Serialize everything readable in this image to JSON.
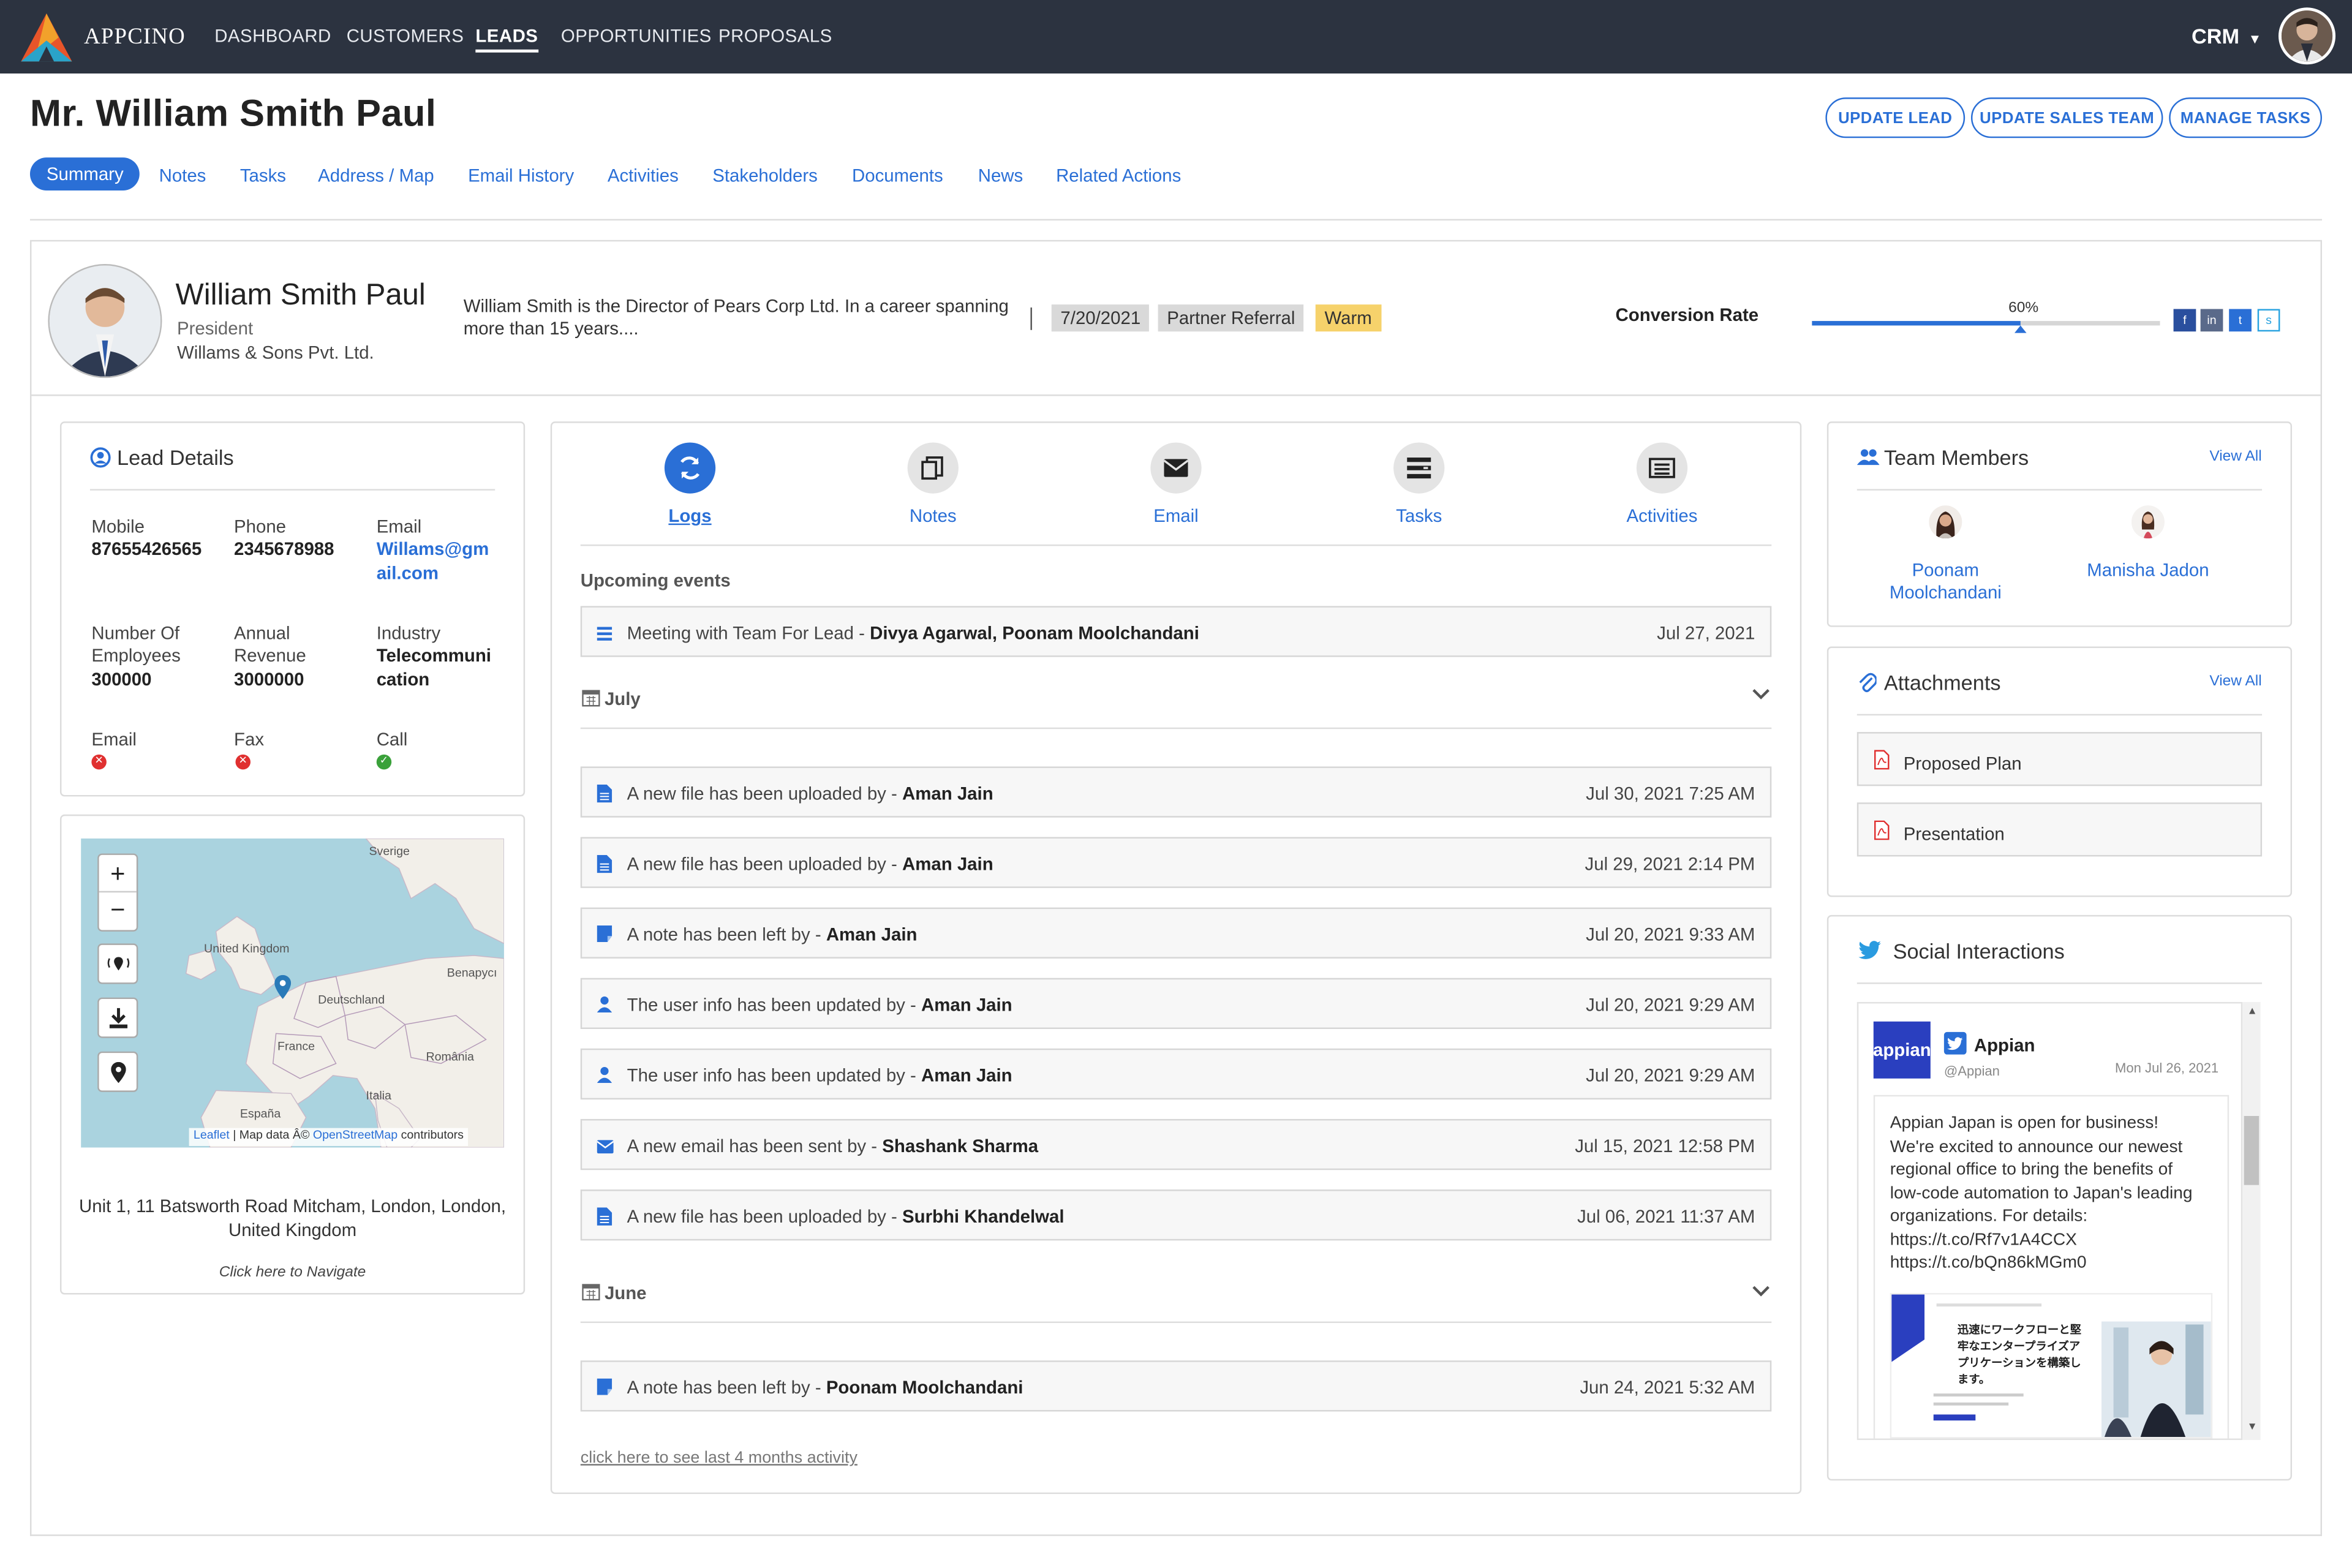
{
  "app": {
    "brand": "APPCINO",
    "crm_label": "CRM"
  },
  "nav": [
    {
      "label": "DASHBOARD"
    },
    {
      "label": "CUSTOMERS"
    },
    {
      "label": "LEADS"
    },
    {
      "label": "OPPORTUNITIES"
    },
    {
      "label": "PROPOSALS"
    }
  ],
  "page": {
    "title": "Mr. William Smith Paul"
  },
  "header_buttons": {
    "update_lead": "UPDATE LEAD",
    "update_sales_team": "UPDATE SALES TEAM",
    "manage_tasks": "MANAGE TASKS"
  },
  "tabs": [
    "Summary",
    "Notes",
    "Tasks",
    "Address / Map",
    "Email History",
    "Activities",
    "Stakeholders",
    "Documents",
    "News",
    "Related Actions"
  ],
  "profile": {
    "name": "William Smith Paul",
    "role": "President",
    "company": "Willams & Sons Pvt. Ltd.",
    "bio_line1": "William Smith is the Director of Pears Corp Ltd. In a career spanning",
    "bio_line2": "more than 15 years....",
    "date": "7/20/2021",
    "source": "Partner Referral",
    "status": "Warm",
    "conversion_label": "Conversion Rate",
    "conversion_text": "60%",
    "conversion_value": 0.6,
    "social": [
      "f",
      "in",
      "t",
      "s"
    ]
  },
  "lead_details": {
    "title": "Lead Details",
    "mobile_label": "Mobile",
    "mobile": "87655426565",
    "phone_label": "Phone",
    "phone": "2345678988",
    "email_label": "Email",
    "email_line1": "Willams@gm",
    "email_line2": "ail.com",
    "employees_label1": "Number Of",
    "employees_label2": "Employees",
    "employees": "300000",
    "revenue_label1": "Annual",
    "revenue_label2": "Revenue",
    "revenue": "3000000",
    "industry_label": "Industry",
    "industry_line1": "Telecommuni",
    "industry_line2": "cation",
    "pref_email": "Email",
    "pref_fax": "Fax",
    "pref_call": "Call",
    "colors": {
      "no": "#e03030",
      "yes": "#3aa13a"
    }
  },
  "map": {
    "labels": {
      "sverige": "Sverige",
      "uk": "United Kingdom",
      "benapyc": "Benapycı",
      "deutschland": "Deutschland",
      "france": "France",
      "romania": "România",
      "italia": "Italia",
      "espana": "España"
    },
    "zoom_in": "+",
    "zoom_out": "−",
    "attribution_leaflet": "Leaflet",
    "attribution_mid": " | Map data Â© ",
    "attribution_osm": "OpenStreetMap",
    "attribution_end": " contributors",
    "address_line1": "Unit 1, 11 Batsworth Road Mitcham, London, London,",
    "address_line2": "United Kingdom",
    "navigate": "Click here to Navigate"
  },
  "activity": {
    "icons": [
      {
        "label": "Logs",
        "icon": "refresh-icon"
      },
      {
        "label": "Notes",
        "icon": "notes-icon"
      },
      {
        "label": "Email",
        "icon": "envelope-icon"
      },
      {
        "label": "Tasks",
        "icon": "tasks-icon"
      },
      {
        "label": "Activities",
        "icon": "activities-icon"
      }
    ],
    "upcoming_title": "Upcoming events",
    "upcoming": {
      "text": "Meeting with Team For Lead",
      "who": "Divya Agarwal, Poonam Moolchandani",
      "date": "Jul 27, 2021"
    },
    "month_july": "July",
    "month_june": "June",
    "july_rows": [
      {
        "text": "A new file has been uploaded by",
        "who": "Aman Jain",
        "date": "Jul 30, 2021 7:25 AM",
        "icon": "file-icon"
      },
      {
        "text": "A new file has been uploaded by",
        "who": "Aman Jain",
        "date": "Jul 29, 2021 2:14 PM",
        "icon": "file-icon"
      },
      {
        "text": "A note has been left by",
        "who": "Aman Jain",
        "date": "Jul 20, 2021 9:33 AM",
        "icon": "note-icon"
      },
      {
        "text": "The user info has been updated by",
        "who": "Aman Jain",
        "date": "Jul 20, 2021 9:29 AM",
        "icon": "user-icon"
      },
      {
        "text": "The user info has been updated by",
        "who": "Aman Jain",
        "date": "Jul 20, 2021 9:29 AM",
        "icon": "user-icon"
      },
      {
        "text": "A new email has been sent by",
        "who": "Shashank Sharma",
        "date": "Jul 15, 2021 12:58 PM",
        "icon": "envelope-icon"
      },
      {
        "text": "A new file has been uploaded by",
        "who": "Surbhi Khandelwal",
        "date": "Jul 06, 2021 11:37 AM",
        "icon": "file-icon"
      }
    ],
    "june_rows": [
      {
        "text": "A note has been left by",
        "who": "Poonam Moolchandani",
        "date": "Jun 24, 2021 5:32 AM",
        "icon": "note-icon"
      }
    ],
    "more_link": "click here to see last 4 months activity",
    "separator": " - "
  },
  "team": {
    "title": "Team Members",
    "view_all": "View All",
    "members": [
      {
        "line1": "Poonam",
        "line2": "Moolchandani"
      },
      {
        "line1": "Manisha Jadon",
        "line2": ""
      }
    ]
  },
  "attachments": {
    "title": "Attachments",
    "view_all": "View All",
    "items": [
      "Proposed Plan",
      "Presentation"
    ]
  },
  "social": {
    "title": "Social Interactions",
    "account": "Appian",
    "handle": "@Appian",
    "date": "Mon Jul 26, 2021",
    "logo_text": "appian",
    "tweet_lines": [
      "Appian Japan is open for business!",
      "We're excited to announce our newest",
      "regional office to bring the benefits of",
      "low-code automation to Japan's leading",
      "organizations. For details:",
      "https://t.co/Rf7v1A4CCX",
      "https://t.co/bQn86kMGm0"
    ],
    "jp_lines": [
      "迅速にワークフローと堅",
      "牢なエンタープライズア",
      "プリケーションを構築し",
      "ます。"
    ]
  }
}
